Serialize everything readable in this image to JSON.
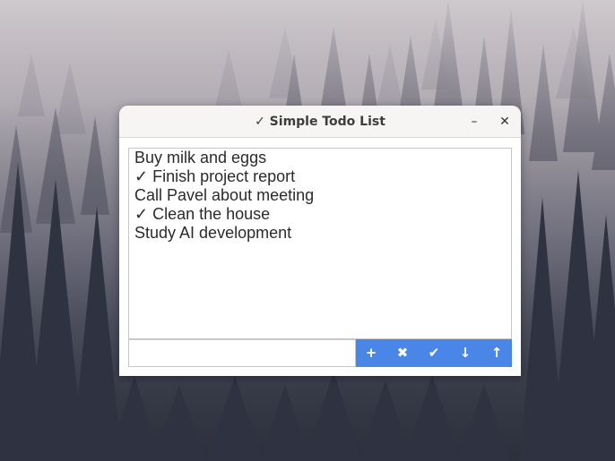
{
  "window": {
    "title": "✓ Simple Todo List",
    "minimize_glyph": "–",
    "close_glyph": "✕"
  },
  "todo_list": {
    "items": [
      {
        "label": "Buy milk and eggs",
        "done": false
      },
      {
        "label": "✓ Finish project report",
        "done": true
      },
      {
        "label": "Call Pavel about meeting",
        "done": false
      },
      {
        "label": "✓ Clean the house",
        "done": true
      },
      {
        "label": "Study AI development",
        "done": false
      }
    ]
  },
  "entry": {
    "value": "",
    "placeholder": ""
  },
  "actions": {
    "add": "+",
    "delete": "✖",
    "complete": "✔",
    "move_down": "↓",
    "move_up": "↑"
  },
  "colors": {
    "accent": "#4a86e8",
    "titlebar": "#f6f5f4",
    "text": "#2b2b2b"
  },
  "icons": {
    "minimize": "minimize-icon",
    "close": "close-icon",
    "add": "plus-icon",
    "delete": "x-icon",
    "complete": "checkmark-icon",
    "move_down": "arrow-down-icon",
    "move_up": "arrow-up-icon"
  }
}
